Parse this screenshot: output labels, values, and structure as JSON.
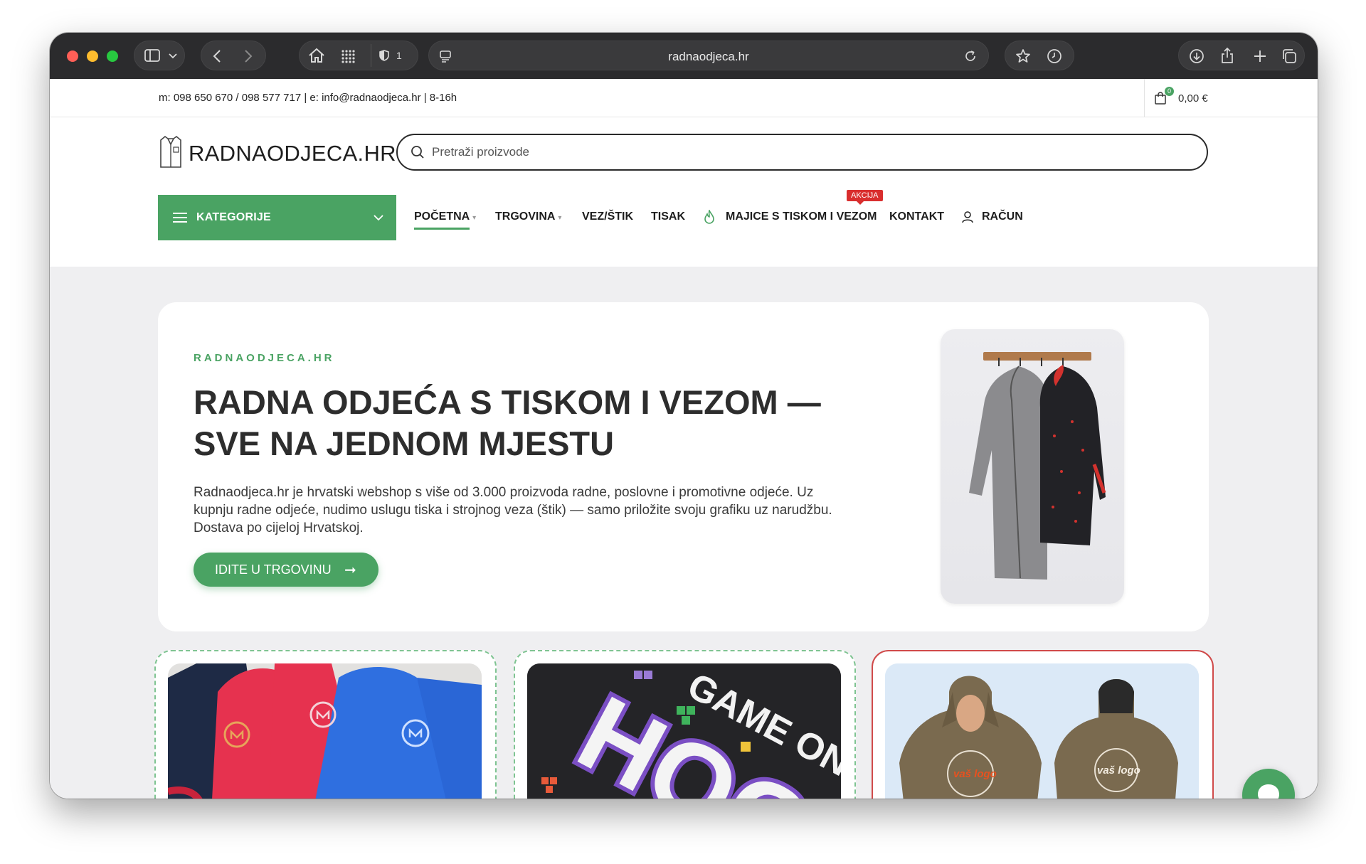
{
  "browser": {
    "url": "radnaodjeca.hr",
    "tab_count": "1"
  },
  "topbar": {
    "contact": "m: 098 650 670 / 098 577 717 | e: info@radnaodjeca.hr | 8-16h",
    "cart_count": "0",
    "cart_total": "0,00 €"
  },
  "header": {
    "logo_text": "RADNAODJECA.HR",
    "search_placeholder": "Pretraži proizvode"
  },
  "nav": {
    "categories_label": "KATEGORIJE",
    "items": [
      {
        "label": "POČETNA"
      },
      {
        "label": "TRGOVINA"
      },
      {
        "label": "VEZ/ŠTIK"
      },
      {
        "label": "TISAK"
      },
      {
        "label": "MAJICE S TISKOM I VEZOM"
      },
      {
        "label": "KONTAKT"
      },
      {
        "label": "RAČUN"
      }
    ],
    "badge": "AKCIJA"
  },
  "hero": {
    "eyebrow": "RADNAODJECA.HR",
    "title": "RADNA ODJEĆA S TISKOM I VEZOM — SVE NA JEDNOM MJESTU",
    "description": "Radnaodjeca.hr je hrvatski webshop s više od 3.000 proizvoda radne, poslovne i promotivne odjeće. Uz kupnju radne odjeće, nudimo uslugu tiska i strojnog veza (štik) — samo priložite svoju grafiku uz narudžbu. Dostava po cijeloj Hrvatskoj.",
    "button_label": "IDITE U TRGOVINU"
  },
  "cards": {
    "hoodie_front_text": "vaš logo",
    "hoodie_back_text": "vaš logo",
    "print_text_1": "HOG",
    "print_text_2": "GAME ON"
  },
  "colors": {
    "brand_green": "#4aa363",
    "accent_red": "#d92e2e",
    "apron_blue": "#2f6fe0",
    "apron_red": "#e6324f",
    "hoodie_olive": "#7a6a4f"
  }
}
